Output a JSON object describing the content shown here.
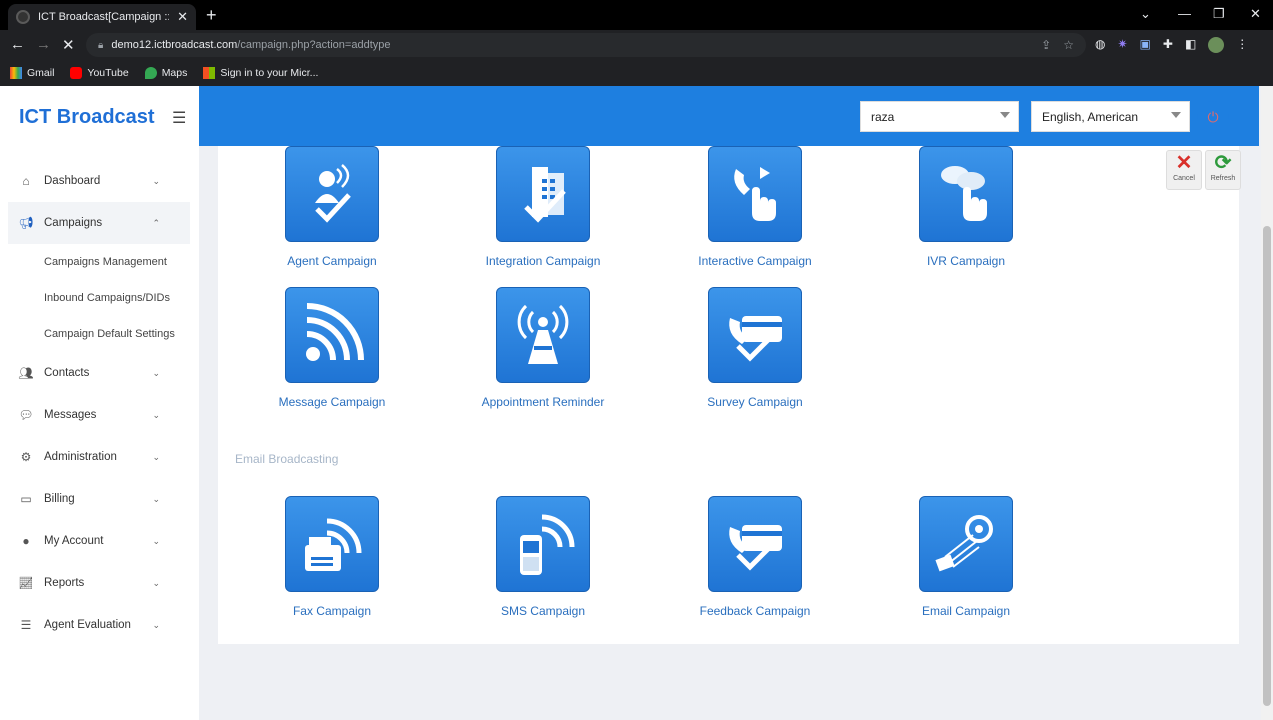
{
  "browser": {
    "tab_title": "ICT Broadcast[Campaign :: Add]",
    "tab_close": "✕",
    "new_tab": "+",
    "url_host": "demo12.ictbroadcast.com",
    "url_path": "/campaign.php?action=addtype",
    "bookmarks": [
      "Gmail",
      "YouTube",
      "Maps",
      "Sign in to your Micr..."
    ]
  },
  "app": {
    "brand": "ICT Broadcast",
    "colors": {
      "accent": "#1e7fe0",
      "brand": "#1f6fd6"
    }
  },
  "sidebar": {
    "items": [
      {
        "label": "Dashboard",
        "icon": "home-icon"
      },
      {
        "label": "Campaigns",
        "icon": "megaphone-icon"
      },
      {
        "label": "Contacts",
        "icon": "users-icon"
      },
      {
        "label": "Messages",
        "icon": "comments-icon"
      },
      {
        "label": "Administration",
        "icon": "cogs-icon"
      },
      {
        "label": "Billing",
        "icon": "wallet-icon"
      },
      {
        "label": "My Account",
        "icon": "user-icon"
      },
      {
        "label": "Reports",
        "icon": "chart-icon"
      },
      {
        "label": "Agent Evaluation",
        "icon": "list-icon"
      }
    ],
    "submenu": [
      "Campaigns Management",
      "Inbound Campaigns/DIDs",
      "Campaign Default Settings"
    ]
  },
  "topbar": {
    "user_select": "raza",
    "language_select": "English, American"
  },
  "actions": {
    "cancel": "Cancel",
    "refresh": "Refresh"
  },
  "campaign_tiles": [
    {
      "label": "Agent Campaign",
      "icon": "agent-check-icon"
    },
    {
      "label": "Integration Campaign",
      "icon": "fax-machine-check-icon"
    },
    {
      "label": "Interactive Campaign",
      "icon": "phone-hand-icon"
    },
    {
      "label": "IVR Campaign",
      "icon": "chat-hand-icon"
    },
    {
      "label": "Message Campaign",
      "icon": "broadcast-waves-icon"
    },
    {
      "label": "Appointment Reminder",
      "icon": "antenna-tower-icon"
    },
    {
      "label": "Survey Campaign",
      "icon": "phone-card-check-icon"
    }
  ],
  "email_section": {
    "title": "Email Broadcasting",
    "tiles": [
      {
        "label": "Fax Campaign",
        "icon": "fax-waves-icon"
      },
      {
        "label": "SMS Campaign",
        "icon": "mobile-waves-icon"
      },
      {
        "label": "Feedback Campaign",
        "icon": "phone-card-check-icon"
      },
      {
        "label": "Email Campaign",
        "icon": "email-at-icon"
      }
    ]
  }
}
